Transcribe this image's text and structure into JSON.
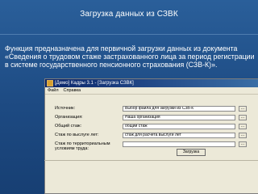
{
  "slide": {
    "title": "Загрузка данных из СЗВК",
    "description": "Функция предназначена для первичной загрузки данных из документа «Сведения о трудовом стаже застрахованного лица за период регистрации в системе государственного пенсионного страхования (СЗВ-К)»."
  },
  "window": {
    "title": "[Демо] Кадры 3.1 - [Загрузка СЗВК]",
    "menu": [
      "Файл",
      "Справка"
    ],
    "fields": [
      {
        "label": "Источник:",
        "value": "Выбор файла для загрузки из СЗВ-К"
      },
      {
        "label": "Организация:",
        "value": "Наша организация"
      },
      {
        "label": "Общий стаж:",
        "value": "общий стаж"
      },
      {
        "label": "Стаж по выслуге лет:",
        "value": "стаж для расчета выслуги лет"
      },
      {
        "label": "Стаж по территориальным условиям труда:",
        "value": ""
      }
    ],
    "browse_label": "...",
    "load_button": "Загрузка"
  }
}
